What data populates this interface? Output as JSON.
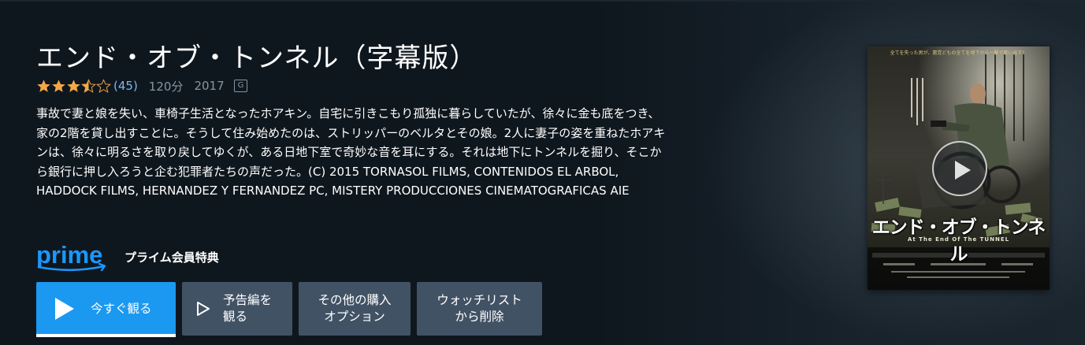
{
  "title": "エンド・オブ・トンネル（字幕版）",
  "rating": {
    "stars": 3.5,
    "max": 5,
    "count": "(45)"
  },
  "duration": "120分",
  "year": "2017",
  "age_rating": "G",
  "synopsis": "事故で妻と娘を失い、車椅子生活となったホアキン。自宅に引きこもり孤独に暮らしていたが、徐々に金も底をつき、家の2階を貸し出すことに。そうして住み始めたのは、ストリッパーのベルタとその娘。2人に妻子の姿を重ねたホアキンは、徐々に明るさを取り戻してゆくが、ある日地下室で奇妙な音を耳にする。それは地下にトンネルを掘り、そこから銀行に押し入ろうと企む犯罪者たちの声だった。(C) 2015 TORNASOL FILMS, CONTENIDOS EL ARBOL, HADDOCK FILMS, HERNANDEZ Y FERNANDEZ PC, MISTERY PRODUCCIONES CINEMATOGRAFICAS AIE",
  "prime": {
    "logo_text": "prime",
    "label": "プライム会員特典"
  },
  "buttons": {
    "watch_now": "今すぐ観る",
    "trailer": "予告編を\n観る",
    "other_purchase": "その他の購入\nオプション",
    "remove_watchlist": "ウォッチリスト\nから削除"
  },
  "poster": {
    "title": "エンド・オブ・トンネル",
    "subtitle": "At The End Of The TUNNEL",
    "tagline": "全てを失った男が、悪党どもの全てを地下から一撃で奪い返す！"
  },
  "colors": {
    "background": "#0f171e",
    "accent": "#1b99f0",
    "secondary_button": "#425265",
    "rating_count": "#79b8f3",
    "meta_text": "#8197a4",
    "star": "#f3a847",
    "prime_blue": "#1a98ff"
  },
  "icons": [
    "star-icon",
    "play-icon",
    "trailer-play-icon",
    "prime-logo",
    "poster-play-icon"
  ]
}
